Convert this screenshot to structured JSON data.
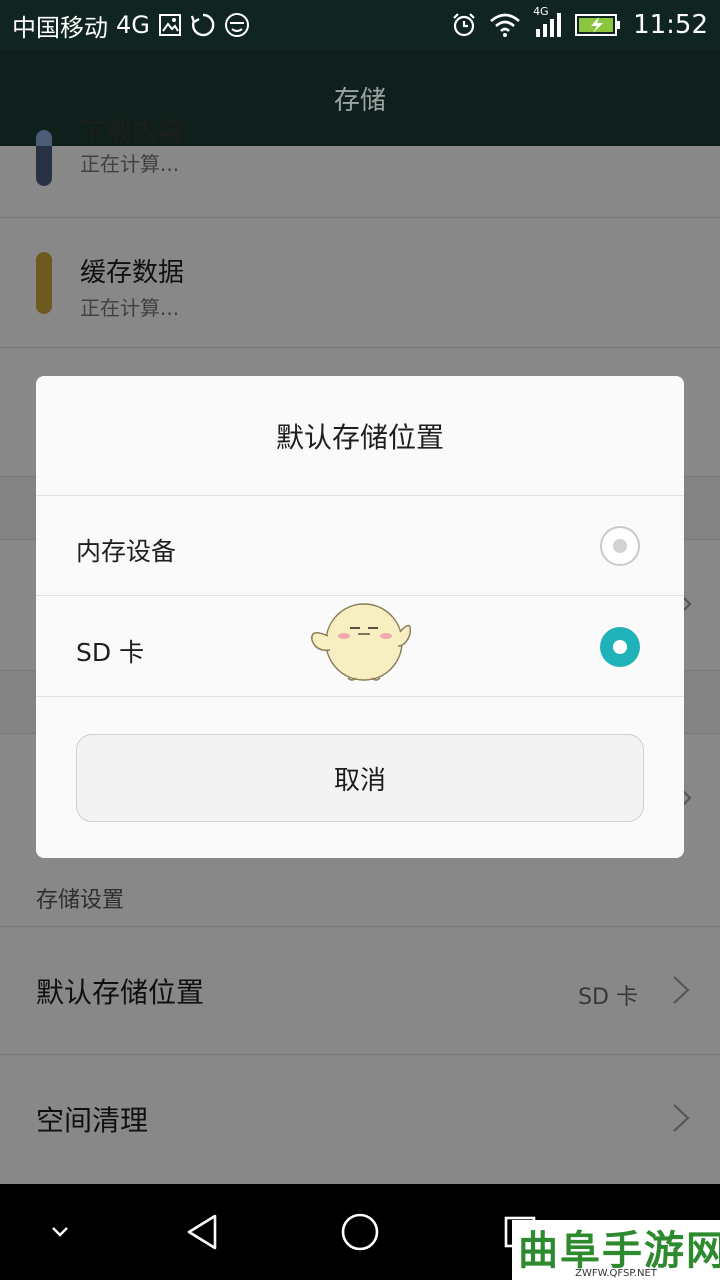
{
  "status_bar": {
    "carrier": "中国移动",
    "network": "4G",
    "signal_badge": "4G",
    "time": "11:52",
    "icons": [
      "image-icon",
      "sync-icon",
      "emoji-icon",
      "alarm-icon",
      "wifi-icon",
      "signal-icon",
      "battery-charging-icon"
    ]
  },
  "title_bar": {
    "title": "存储"
  },
  "background": {
    "usage_rows": [
      {
        "title": "下载内容",
        "subtitle": "正在计算...",
        "color": "#4a5c78"
      },
      {
        "title": "缓存数据",
        "subtitle": "正在计算...",
        "color": "#c9a43a"
      }
    ],
    "section_header": "存储设置",
    "settings": [
      {
        "label": "默认存储位置",
        "value": "SD 卡"
      },
      {
        "label": "空间清理",
        "value": ""
      }
    ]
  },
  "dialog": {
    "title": "默认存储位置",
    "options": [
      {
        "label": "内存设备",
        "selected": false
      },
      {
        "label": "SD 卡",
        "selected": true
      }
    ],
    "cancel_label": "取消"
  },
  "nav_bar": {
    "icons": [
      "chevron-down-icon",
      "back-icon",
      "home-icon",
      "recents-icon"
    ]
  },
  "watermark": {
    "text": "曲阜手游网",
    "url": "ZWFW.QFSP.NET"
  },
  "colors": {
    "accent": "#1fb2b8",
    "title_bar": "#0f1f1c",
    "status_bar": "#102521"
  }
}
